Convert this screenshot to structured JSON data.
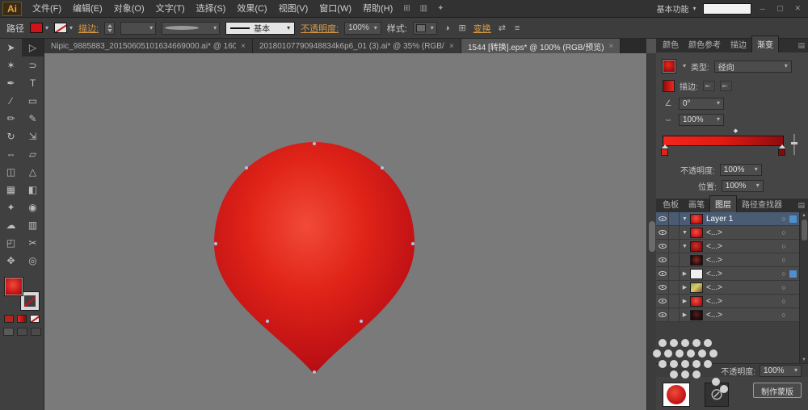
{
  "app": {
    "logo_text": "Ai"
  },
  "menubar": {
    "items": [
      "文件(F)",
      "编辑(E)",
      "对象(O)",
      "文字(T)",
      "选择(S)",
      "效果(C)",
      "视图(V)",
      "窗口(W)",
      "帮助(H)"
    ],
    "workspace_switcher": "基本功能",
    "search_value": ""
  },
  "controlbar": {
    "selection_label": "路径",
    "stroke_link": "描边:",
    "stroke_style_value": "基本",
    "opacity_link": "不透明度:",
    "opacity_value": "100%",
    "style_label": "样式:",
    "transform_link": "变换"
  },
  "doc_tabs": [
    {
      "label": "Nipic_9885883_20150605101634669000.ai* @ 160...",
      "close": "×",
      "state": ""
    },
    {
      "label": "20180107790948834k6p6_01 (3).ai* @ 35% (RGB/...",
      "close": "×",
      "state": ""
    },
    {
      "label": "1544 [转换].eps* @ 100% (RGB/预览)",
      "close": "×",
      "state": "active"
    }
  ],
  "toolbar_tools": [
    {
      "name": "selection-tool",
      "glyph": "➤"
    },
    {
      "name": "direct-selection-tool",
      "glyph": "▷",
      "state": "active"
    },
    {
      "name": "magic-wand-tool",
      "glyph": "✶"
    },
    {
      "name": "lasso-tool",
      "glyph": "⊃"
    },
    {
      "name": "pen-tool",
      "glyph": "✒"
    },
    {
      "name": "type-tool",
      "glyph": "T"
    },
    {
      "name": "line-segment-tool",
      "glyph": "∕"
    },
    {
      "name": "rectangle-tool",
      "glyph": "▭"
    },
    {
      "name": "paintbrush-tool",
      "glyph": "✏"
    },
    {
      "name": "pencil-tool",
      "glyph": "✎"
    },
    {
      "name": "rotate-tool",
      "glyph": "↻"
    },
    {
      "name": "scale-tool",
      "glyph": "⇲"
    },
    {
      "name": "width-tool",
      "glyph": "⇔"
    },
    {
      "name": "free-transform-tool",
      "glyph": "▱"
    },
    {
      "name": "shape-builder-tool",
      "glyph": "◫"
    },
    {
      "name": "perspective-grid-tool",
      "glyph": "△"
    },
    {
      "name": "mesh-tool",
      "glyph": "▦"
    },
    {
      "name": "gradient-tool",
      "glyph": "◧"
    },
    {
      "name": "eyedropper-tool",
      "glyph": "✦"
    },
    {
      "name": "blend-tool",
      "glyph": "◉"
    },
    {
      "name": "symbol-sprayer-tool",
      "glyph": "☁"
    },
    {
      "name": "column-graph-tool",
      "glyph": "▥"
    },
    {
      "name": "artboard-tool",
      "glyph": "◰"
    },
    {
      "name": "slice-tool",
      "glyph": "✂"
    },
    {
      "name": "hand-tool",
      "glyph": "✥"
    },
    {
      "name": "zoom-tool",
      "glyph": "◎"
    }
  ],
  "gradient_panel": {
    "tabs": [
      {
        "label": "颜色",
        "state": ""
      },
      {
        "label": "颜色参考",
        "state": ""
      },
      {
        "label": "描边",
        "state": ""
      },
      {
        "label": "渐变",
        "state": "active"
      }
    ],
    "type_label": "类型:",
    "type_value": "径向",
    "stroke_label": "描边:",
    "angle_value": "0°",
    "aspect_value": "100%",
    "opacity_label": "不透明度:",
    "opacity_value": "100%",
    "location_label": "位置:",
    "location_value": "100%"
  },
  "layers_panel": {
    "tabs": [
      {
        "label": "色板",
        "state": ""
      },
      {
        "label": "画笔",
        "state": ""
      },
      {
        "label": "图层",
        "state": "active"
      },
      {
        "label": "路径查找器",
        "state": ""
      }
    ],
    "rows": [
      {
        "twisty": "▼",
        "thumb": "t-red",
        "name": "Layer 1",
        "rowstate": "rowsel",
        "selon": "on"
      },
      {
        "twisty": "▼",
        "thumb": "t-red",
        "name": "<...>",
        "rowstate": "",
        "selon": ""
      },
      {
        "twisty": "▼",
        "thumb": "t-red2",
        "name": "<...>",
        "rowstate": "",
        "selon": ""
      },
      {
        "twisty": "",
        "thumb": "t-dark",
        "name": "<...>",
        "rowstate": "",
        "selon": ""
      },
      {
        "twisty": "▶",
        "thumb": "t-white",
        "name": "<...>",
        "rowstate": "",
        "selon": "on"
      },
      {
        "twisty": "▶",
        "thumb": "t-photo",
        "name": "<...>",
        "rowstate": "",
        "selon": ""
      },
      {
        "twisty": "▶",
        "thumb": "t-red",
        "name": "<...>",
        "rowstate": "",
        "selon": ""
      },
      {
        "twisty": "▶",
        "thumb": "t-dark2",
        "name": "<...>",
        "rowstate": "",
        "selon": ""
      }
    ]
  },
  "transparency_panel": {
    "opacity_label": "不透明度:",
    "opacity_value": "100%",
    "make_mask_button": "制作蒙版"
  },
  "icons": {
    "caret_down": "▾",
    "close": "×",
    "target": "○",
    "prohibit": "⊘",
    "panel_menu": "▤",
    "diamond_stop": "◆",
    "scroll_up": "▲",
    "scroll_down": "▼",
    "window_min": "─",
    "window_max": "▢",
    "window_close": "✕",
    "arrange": "⊞",
    "grid": "▥",
    "tool_extra": "✦",
    "recolor": "◑",
    "align": "⊞",
    "transform_extra": "⇄",
    "menu_lines": "≡",
    "angle": "∠",
    "aspect": "⇔"
  },
  "colors": {
    "accent_link": "#d89b45",
    "canvas_gray": "#7a7a7a",
    "blob_center": "#f14a39",
    "blob_mid": "#e02418",
    "blob_edge": "#9d0a0e",
    "gradient_bar_start": "#f2261c",
    "gradient_bar_end": "#8e0c0f",
    "selection_blue": "#4f8fd0"
  }
}
